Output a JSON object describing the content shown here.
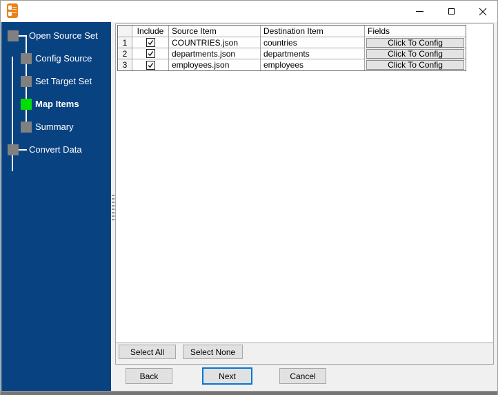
{
  "colors": {
    "sidebar_bg": "#094280",
    "active_step_green": "#00DD00",
    "focus_blue": "#0078D7",
    "titlebar_bg": "#FFFFFF",
    "form_bg": "#F0F0F0"
  },
  "titlebar": {
    "app_icon": "converter-app-icon",
    "controls": {
      "minimize": "minimize-icon",
      "maximize": "maximize-icon",
      "close": "close-icon"
    }
  },
  "sidebar": {
    "steps": [
      {
        "label": "Open Source Set",
        "level": 0,
        "active": false
      },
      {
        "label": "Config Source",
        "level": 1,
        "active": false
      },
      {
        "label": "Set Target Set",
        "level": 1,
        "active": false
      },
      {
        "label": "Map Items",
        "level": 1,
        "active": true
      },
      {
        "label": "Summary",
        "level": 1,
        "active": false
      },
      {
        "label": "Convert Data",
        "level": 0,
        "active": false
      }
    ]
  },
  "table": {
    "headers": {
      "row": "",
      "include": "Include",
      "source": "Source Item",
      "destination": "Destination Item",
      "fields": "Fields"
    },
    "rows": [
      {
        "num": "1",
        "include": true,
        "source": "COUNTRIES.json",
        "destination": "countries",
        "fields_button": "Click To Config"
      },
      {
        "num": "2",
        "include": true,
        "source": "departments.json",
        "destination": "departments",
        "fields_button": "Click To Config"
      },
      {
        "num": "3",
        "include": true,
        "source": "employees.json",
        "destination": "employees",
        "fields_button": "Click To Config"
      }
    ]
  },
  "selection_buttons": {
    "select_all": "Select All",
    "select_none": "Select None"
  },
  "nav_buttons": {
    "back": "Back",
    "next": "Next",
    "cancel": "Cancel"
  }
}
